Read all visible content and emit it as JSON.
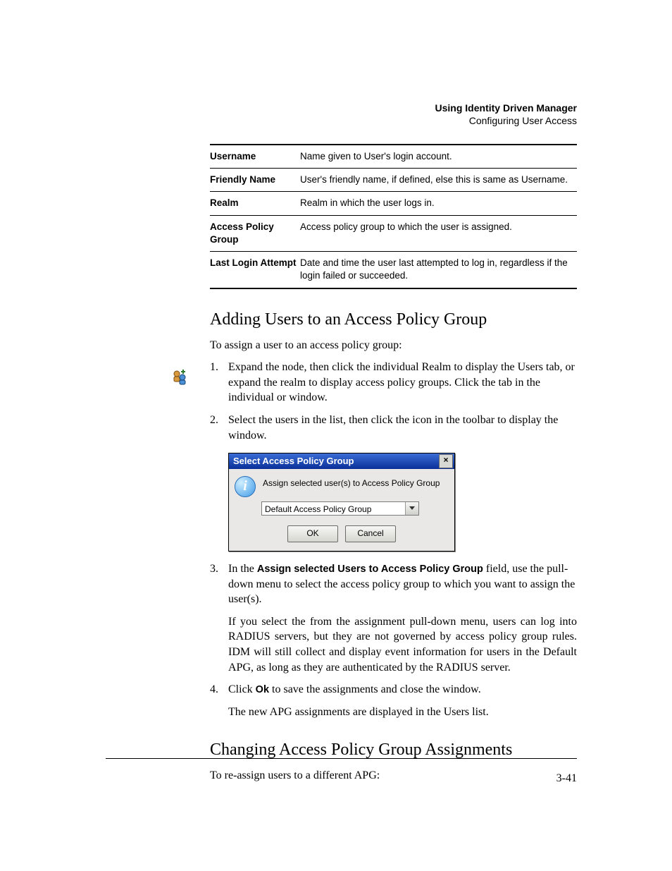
{
  "header": {
    "title": "Using Identity Driven Manager",
    "subtitle": "Configuring User Access"
  },
  "definitions": [
    {
      "term": "Username",
      "desc": "Name given to User's login account."
    },
    {
      "term": "Friendly Name",
      "desc": "User's friendly name, if defined, else this is same as Username."
    },
    {
      "term": "Realm",
      "desc": "Realm in which the user logs in."
    },
    {
      "term": "Access Policy Group",
      "desc": "Access policy group to which the user is assigned."
    },
    {
      "term": "Last Login Attempt",
      "desc": "Date and time the user last attempted to log in, regardless if the login failed or succeeded."
    }
  ],
  "section1": {
    "heading": "Adding Users to an Access Policy Group",
    "intro": "To assign a user to an access policy group:",
    "steps": {
      "s1": {
        "a": "Expand the ",
        "b": " node, then click the individual Realm to display the Users tab, or expand the realm to display access policy groups. Click the ",
        "c": " tab in the individual ",
        "d": " or ",
        "e": " window."
      },
      "s2": {
        "a": "Select the users in the list, then click the ",
        "b": " icon in the toolbar to display the ",
        "c": " window."
      },
      "s3": {
        "a": "In the ",
        "bold": "Assign selected Users to Access Policy Group",
        "b": "  field, use the pull-down menu to select the access policy group to which you want to assign the user(s).",
        "p2a": "If you select the ",
        "p2b": " from the assignment pull-down menu, users can log into RADIUS servers, but they are not governed by access policy group rules. IDM will still collect and display event information for users in the Default APG, as long as they are authenticated by the RADIUS server."
      },
      "s4": {
        "a": "Click ",
        "bold": "Ok",
        "b": " to save the assignments and close the window.",
        "p2": "The new APG assignments are displayed in the Users list."
      }
    }
  },
  "dialog": {
    "title": "Select Access Policy Group",
    "close": "×",
    "label": "Assign selected user(s) to Access Policy Group",
    "combo_value": "Default Access Policy Group",
    "ok": "OK",
    "cancel": "Cancel"
  },
  "section2": {
    "heading": "Changing Access Policy Group Assignments",
    "intro": "To re-assign users to a different APG:"
  },
  "page_number": "3-41"
}
